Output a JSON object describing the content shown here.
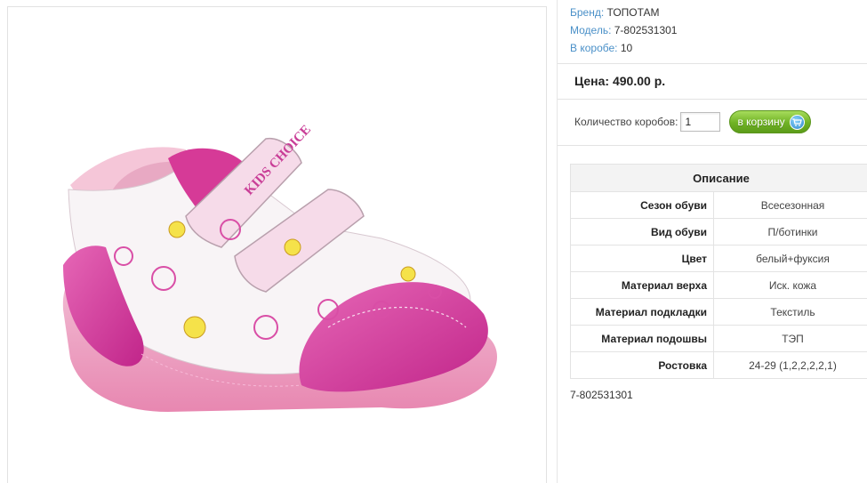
{
  "product": {
    "brand_label": "Бренд:",
    "brand": "ТОПОТАМ",
    "model_label": "Модель:",
    "model": "7-802531301",
    "box_label": "В коробе:",
    "box_qty": "10",
    "price": "Цена: 490.00 р.",
    "image_text": "KIDS CHOICE"
  },
  "cart": {
    "qty_label": "Количество коробов:",
    "qty_value": "1",
    "button_label": "в корзину",
    "button_icon": "cart-icon"
  },
  "specs": {
    "header": "Описание",
    "rows": [
      {
        "key": "Сезон обуви",
        "value": "Всесезонная"
      },
      {
        "key": "Вид обуви",
        "value": "П/ботинки"
      },
      {
        "key": "Цвет",
        "value": "белый+фуксия"
      },
      {
        "key": "Материал верха",
        "value": "Иск. кожа"
      },
      {
        "key": "Материал подкладки",
        "value": "Текстиль"
      },
      {
        "key": "Материал подошвы",
        "value": "ТЭП"
      },
      {
        "key": "Ростовка",
        "value": "24-29 (1,2,2,2,2,1)"
      }
    ]
  },
  "footer_model": "7-802531301",
  "colors": {
    "link": "#4a90c8",
    "button_green": "#6fb224",
    "shoe_pink": "#d9359a"
  }
}
